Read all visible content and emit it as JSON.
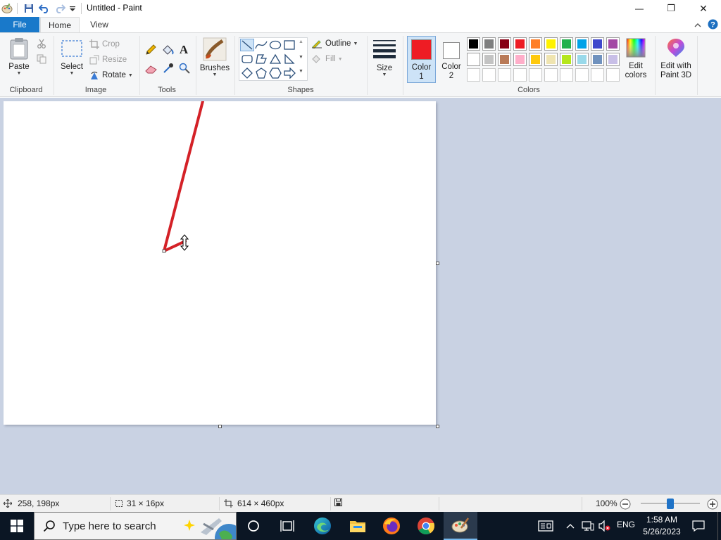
{
  "window": {
    "title": "Untitled - Paint",
    "minimize_glyph": "—",
    "restore_glyph": "❐",
    "close_glyph": "✕"
  },
  "tabs": [
    {
      "label": "File"
    },
    {
      "label": "Home"
    },
    {
      "label": "View"
    }
  ],
  "ribbon": {
    "clipboard": {
      "label": "Clipboard",
      "paste": "Paste"
    },
    "image": {
      "label": "Image",
      "select": "Select",
      "crop": "Crop",
      "resize": "Resize",
      "rotate": "Rotate"
    },
    "tools": {
      "label": "Tools"
    },
    "brushes": {
      "label": "Brushes"
    },
    "shapes": {
      "label": "Shapes",
      "outline": "Outline",
      "fill": "Fill"
    },
    "size": {
      "label": "Size"
    },
    "color1": {
      "label": "Color 1",
      "line1": "Color",
      "line2": "1",
      "value": "#ee1c24"
    },
    "color2": {
      "label": "Color 2",
      "line1": "Color",
      "line2": "2",
      "value": "#ffffff"
    },
    "colors": {
      "label": "Colors"
    },
    "edit_colors": {
      "line1": "Edit",
      "line2": "colors"
    },
    "paint3d": {
      "line1": "Edit with",
      "line2": "Paint 3D"
    }
  },
  "palette": {
    "row1": [
      "#000000",
      "#7f7f7f",
      "#880015",
      "#ed1c24",
      "#ff7f27",
      "#fff200",
      "#22b14c",
      "#00a2e8",
      "#3f48cc",
      "#a349a4"
    ],
    "row2": [
      "#ffffff",
      "#c3c3c3",
      "#b97a57",
      "#ffaec9",
      "#ffc90e",
      "#efe4b0",
      "#b5e61d",
      "#99d9ea",
      "#7092be",
      "#c8bfe7"
    ],
    "row3_empty_count": 10
  },
  "drawing": {
    "stroke_color": "#d42127"
  },
  "status": {
    "cursor_pos": "258, 198px",
    "selection_size": "31 × 16px",
    "canvas_size": "614 × 460px",
    "zoom": "100%",
    "zoom_level": 0.5
  },
  "taskbar": {
    "search_placeholder": "Type here to search",
    "lang": "ENG",
    "time": "1:58 AM",
    "date": "5/26/2023"
  }
}
